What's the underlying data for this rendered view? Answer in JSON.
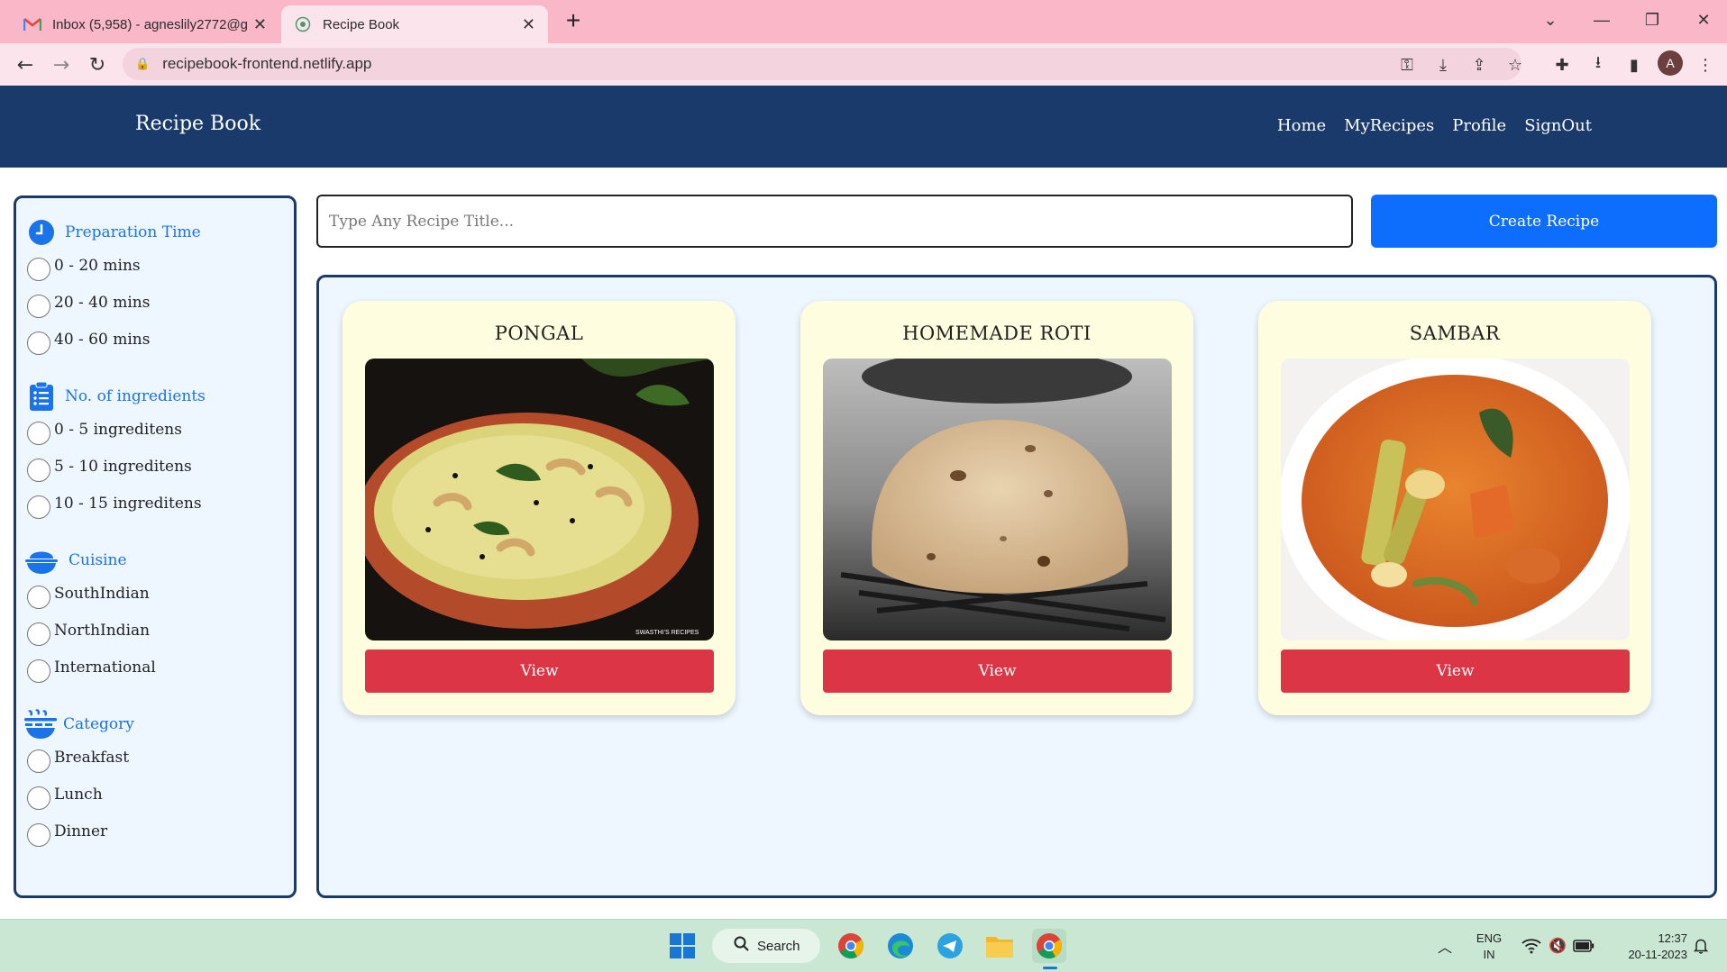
{
  "browser": {
    "tabs": [
      {
        "title": "Inbox (5,958) - agneslily2772@g",
        "favicon": "gmail-icon",
        "active": false
      },
      {
        "title": "Recipe Book",
        "favicon": "globe-icon",
        "active": true
      }
    ],
    "url": "recipebook-frontend.netlify.app",
    "new_tab_label": "+"
  },
  "app": {
    "brand": "Recipe Book",
    "nav": {
      "home": "Home",
      "myrecipes": "MyRecipes",
      "profile": "Profile",
      "signout": "SignOut"
    }
  },
  "filters": {
    "prep_time": {
      "title": "Preparation Time",
      "icon": "clock-icon",
      "options": [
        "0 - 20 mins",
        "20 - 40 mins",
        "40 - 60 mins"
      ]
    },
    "ingredients": {
      "title": "No. of ingredients",
      "icon": "list-icon",
      "options": [
        "0 - 5 ingreditens",
        "5 - 10 ingreditens",
        "10 - 15 ingreditens"
      ]
    },
    "cuisine": {
      "title": "Cuisine",
      "icon": "bowl-icon",
      "options": [
        "SouthIndian",
        "NorthIndian",
        "International"
      ]
    },
    "category": {
      "title": "Category",
      "icon": "food-icon",
      "options": [
        "Breakfast",
        "Lunch",
        "Dinner"
      ]
    }
  },
  "search": {
    "placeholder": "Type Any Recipe Title...",
    "value": ""
  },
  "create_button": "Create Recipe",
  "recipes": [
    {
      "title": "PONGAL",
      "view_label": "View",
      "image_watermark": "SWASTHI'S RECIPES"
    },
    {
      "title": "HOMEMADE ROTI",
      "view_label": "View"
    },
    {
      "title": "SAMBAR",
      "view_label": "View"
    }
  ],
  "taskbar": {
    "search_label": "Search",
    "lang_line1": "ENG",
    "lang_line2": "IN",
    "time": "12:37",
    "date": "20-11-2023"
  },
  "colors": {
    "navbar": "#1a3a6b",
    "primary_button": "#0d6efd",
    "view_button": "#dc3545",
    "card_bg": "#fffde0",
    "filter_accent": "#1a73e8"
  }
}
